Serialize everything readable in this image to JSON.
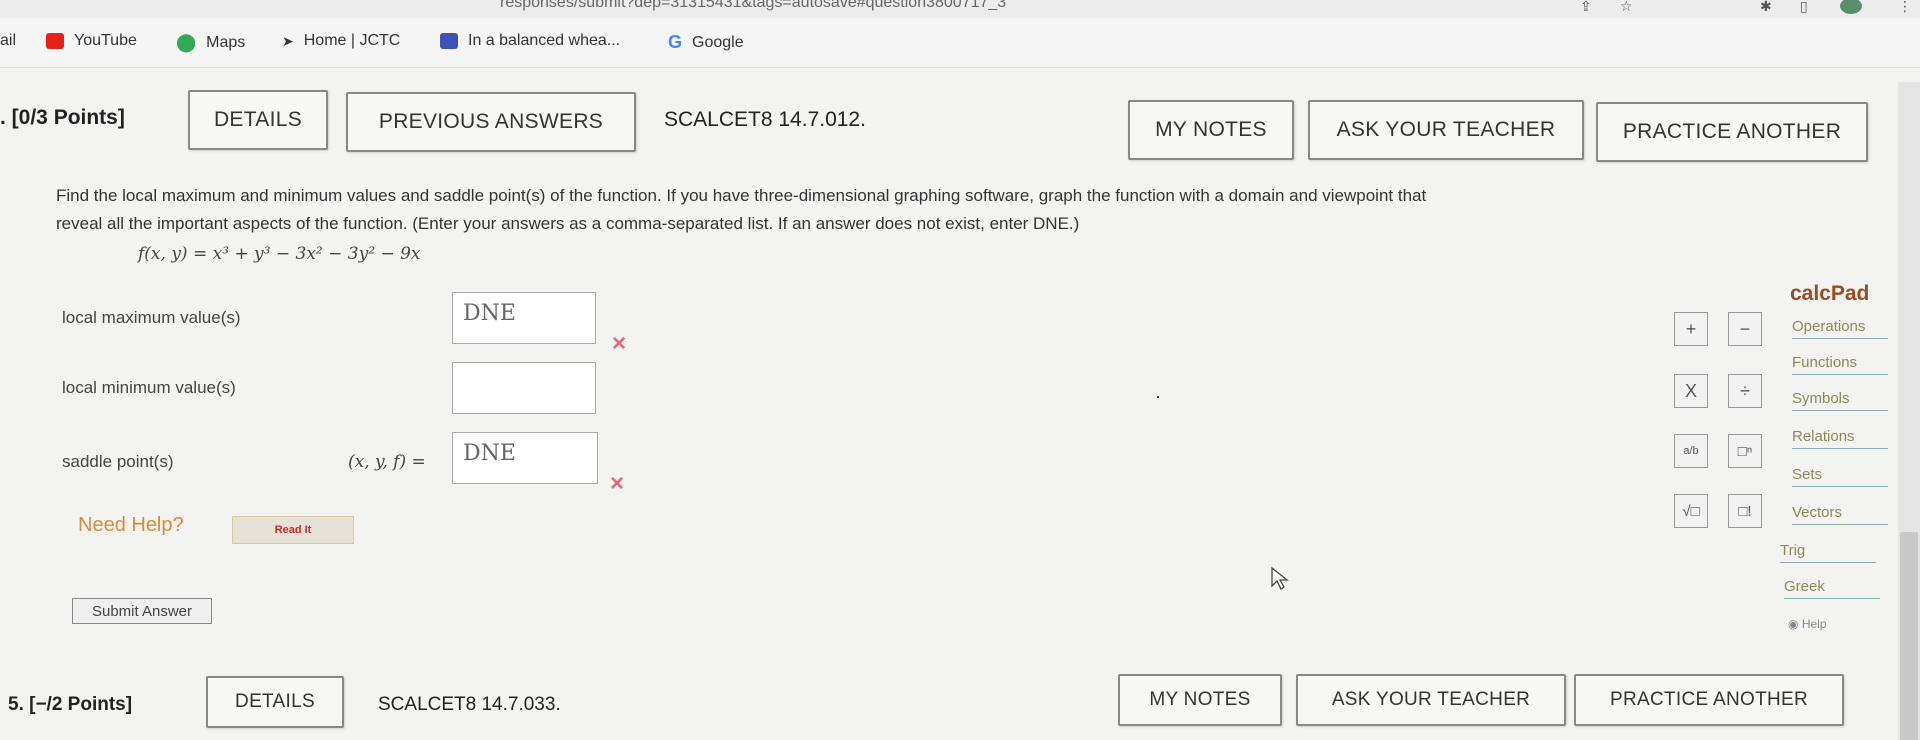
{
  "browser": {
    "url_fragment": "responses/submit?dep=31315431&tags=autosave#question3800717_3",
    "bookmarks": [
      {
        "label": "ail",
        "icon": "none"
      },
      {
        "label": "YouTube",
        "icon": "youtube-icon",
        "color": "#e62117"
      },
      {
        "label": "Maps",
        "icon": "maps-pin-icon",
        "color": "#34a853"
      },
      {
        "label": "Home | JCTC",
        "icon": "jctc-icon",
        "color": "#333333"
      },
      {
        "label": "In a balanced whea...",
        "icon": "bookmark-app-icon",
        "color": "#3f51b5"
      },
      {
        "label": "Google",
        "icon": "google-icon",
        "color": "#4285f4"
      }
    ]
  },
  "question": {
    "points": ". [0/3 Points]",
    "details_label": "DETAILS",
    "previous_answers_label": "PREVIOUS ANSWERS",
    "question_id": "SCALCET8 14.7.012.",
    "my_notes_label": "MY NOTES",
    "ask_teacher_label": "ASK YOUR TEACHER",
    "practice_another_label": "PRACTICE ANOTHER",
    "prompt_line1": "Find the local maximum and minimum values and saddle point(s) of the function. If you have three-dimensional graphing software, graph the function with a domain and viewpoint that",
    "prompt_line2": "reveal all the important aspects of the function. (Enter your answers as a comma-separated list. If an answer does not exist, enter DNE.)",
    "function_text": "f(x, y) = x³ + y³ − 3x² − 3y² − 9x",
    "fields": {
      "local_max": {
        "label": "local maximum value(s)",
        "value": "DNE",
        "status": "incorrect"
      },
      "local_min": {
        "label": "local minimum value(s)",
        "value": "",
        "status": "none"
      },
      "saddle": {
        "label": "saddle point(s)",
        "prefix": "(x, y, f) =",
        "value": "DNE",
        "status": "incorrect"
      }
    },
    "incorrect_mark": "×",
    "need_help": "Need Help?",
    "read_it": "Read It",
    "submit_label": "Submit Answer"
  },
  "calcpad": {
    "title": "calcPad",
    "buttons": [
      "+",
      "−",
      "X",
      "÷",
      "a/b",
      "□ⁿ",
      "√□",
      "□!"
    ],
    "categories": [
      "Operations",
      "Functions",
      "Symbols",
      "Relations",
      "Sets",
      "Vectors",
      "Trig",
      "Greek"
    ],
    "help": "Help"
  },
  "next_question": {
    "points": "5. [−/2 Points]",
    "details_label": "DETAILS",
    "question_id": "SCALCET8 14.7.033.",
    "my_notes_label": "MY NOTES",
    "ask_teacher_label": "ASK YOUR TEACHER",
    "practice_another_label": "PRACTICE ANOTHER"
  }
}
